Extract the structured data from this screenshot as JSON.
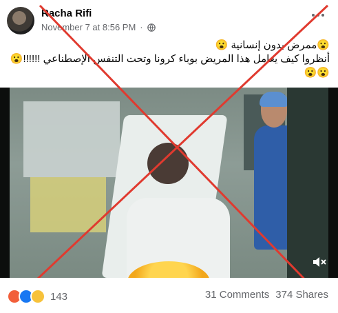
{
  "post": {
    "author": "Racha Rifi",
    "timestamp": "November 7 at 8:56 PM",
    "separator": "·",
    "privacy_icon": "globe-icon",
    "caption_lines": [
      "😮ممرض بدون إنسانية 😮",
      "أنظروا كيف يعامل هذا المريض بوباء كرونا وتحت التنفس الإصطناعي !!!!!!😮",
      "😮😮"
    ]
  },
  "video": {
    "overlay_text": "",
    "mute_icon": "speaker-muted-icon",
    "overlay_mark": "red-x-icon",
    "overlay_color": "#e03a2f"
  },
  "footer": {
    "reaction_icons": [
      "angry-icon",
      "like-icon",
      "sad-icon"
    ],
    "reaction_count": "143",
    "comments": "31 Comments",
    "shares": "374 Shares"
  },
  "colors": {
    "accent": "#1877f2",
    "muted": "#65676b",
    "text": "#050505"
  }
}
